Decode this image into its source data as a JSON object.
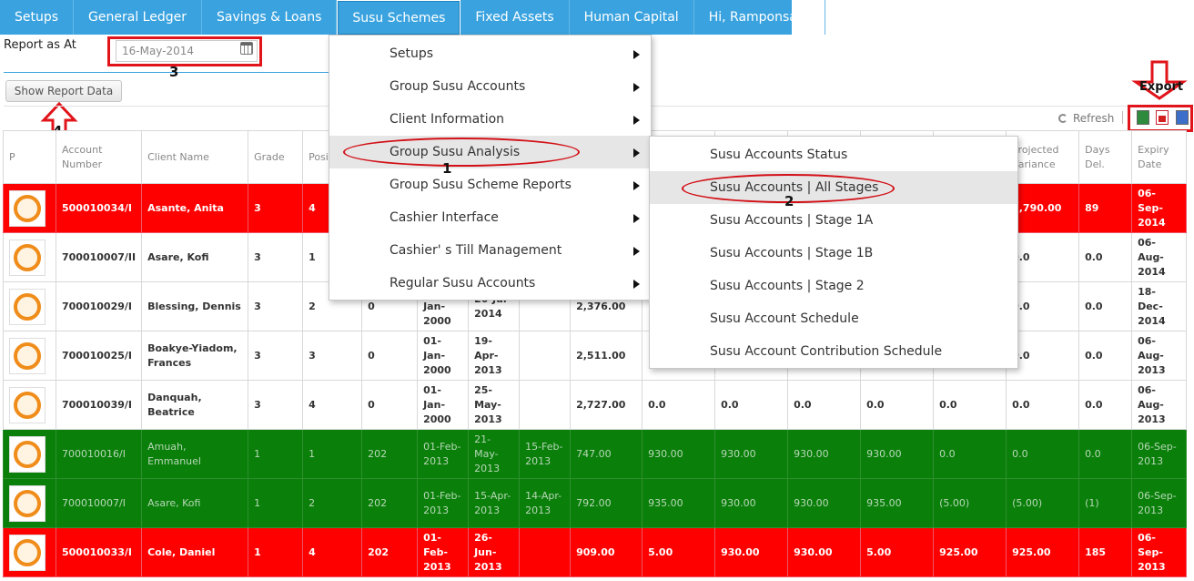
{
  "nav": {
    "items": [
      "Setups",
      "General Ledger",
      "Savings & Loans",
      "Susu Schemes",
      "Fixed Assets",
      "Human Capital",
      "Hi, Ramponsah!"
    ],
    "active_index": 3
  },
  "report": {
    "label": "Report as At",
    "date": "16-May-2014",
    "show_button": "Show Report Data"
  },
  "toolbar": {
    "refresh": "Refresh",
    "export": "Export"
  },
  "annotations": [
    "1",
    "2",
    "3",
    "4"
  ],
  "menu": {
    "items": [
      "Setups",
      "Group Susu Accounts",
      "Client Information",
      "Group Susu Analysis",
      "Group Susu Scheme Reports",
      "Cashier Interface",
      "Cashier' s Till Management",
      "Regular Susu Accounts"
    ],
    "highlighted_index": 3
  },
  "submenu": {
    "items": [
      "Susu Accounts Status",
      "Susu Accounts | All Stages",
      "Susu Accounts | Stage 1A",
      "Susu Accounts | Stage 1B",
      "Susu Accounts | Stage 2",
      "Susu Account Schedule",
      "Susu Account Contribution Schedule"
    ],
    "highlighted_index": 1
  },
  "table": {
    "headers": [
      "P",
      "Account Number",
      "Client Name",
      "Grade",
      "Posi",
      "",
      "",
      "",
      "",
      "",
      "",
      "",
      "",
      "",
      "",
      "Projected Variance",
      "Days Del.",
      "Expiry Date"
    ],
    "rows": [
      {
        "status": "red",
        "cells": [
          "",
          "500010034/I",
          "Asante, Anita",
          "3",
          "4",
          "",
          "",
          "",
          "",
          "",
          "",
          "",
          "",
          "",
          "",
          "2,790.00",
          "89",
          "06-Sep-2014"
        ]
      },
      {
        "status": "white",
        "cells": [
          "",
          "700010007/II",
          "Asare, Kofi",
          "3",
          "1",
          "",
          "",
          "",
          "",
          "",
          "",
          "",
          "",
          "",
          "",
          "0.0",
          "0.0",
          "06-Aug-2014"
        ]
      },
      {
        "status": "white",
        "cells": [
          "",
          "700010029/I",
          "Blessing, Dennis",
          "3",
          "2",
          "0",
          "01-Jan-2000",
          "20-Jul-2014",
          "",
          "2,376.00",
          "",
          "",
          "",
          "",
          "",
          "0.0",
          "0.0",
          "18-Dec-2014"
        ]
      },
      {
        "status": "white",
        "cells": [
          "",
          "700010025/I",
          "Boakye-Yiadom, Frances",
          "3",
          "3",
          "0",
          "01-Jan-2000",
          "19-Apr-2013",
          "",
          "2,511.00",
          "",
          "",
          "",
          "",
          "",
          "0.0",
          "0.0",
          "06-Aug-2013"
        ]
      },
      {
        "status": "white",
        "cells": [
          "",
          "700010039/I",
          "Danquah, Beatrice",
          "3",
          "4",
          "0",
          "01-Jan-2000",
          "25-May-2013",
          "",
          "2,727.00",
          "0.0",
          "0.0",
          "0.0",
          "0.0",
          "0.0",
          "0.0",
          "0.0",
          "06-Aug-2013"
        ]
      },
      {
        "status": "green",
        "cells": [
          "",
          "700010016/I",
          "Amuah, Emmanuel",
          "1",
          "1",
          "202",
          "01-Feb-2013",
          "21-May-2013",
          "15-Feb-2013",
          "747.00",
          "930.00",
          "930.00",
          "930.00",
          "930.00",
          "0.0",
          "0.0",
          "0.0",
          "06-Sep-2013"
        ]
      },
      {
        "status": "green",
        "cells": [
          "",
          "700010007/I",
          "Asare, Kofi",
          "1",
          "2",
          "202",
          "01-Feb-2013",
          "15-Apr-2013",
          "14-Apr-2013",
          "792.00",
          "935.00",
          "930.00",
          "930.00",
          "935.00",
          "(5.00)",
          "(5.00)",
          "(1)",
          "06-Sep-2013"
        ]
      },
      {
        "status": "red",
        "cells": [
          "",
          "500010033/I",
          "Cole, Daniel",
          "1",
          "4",
          "202",
          "01-Feb-2013",
          "26-Jun-2013",
          "",
          "909.00",
          "5.00",
          "930.00",
          "930.00",
          "5.00",
          "925.00",
          "925.00",
          "185",
          "06-Sep-2013"
        ]
      }
    ]
  }
}
